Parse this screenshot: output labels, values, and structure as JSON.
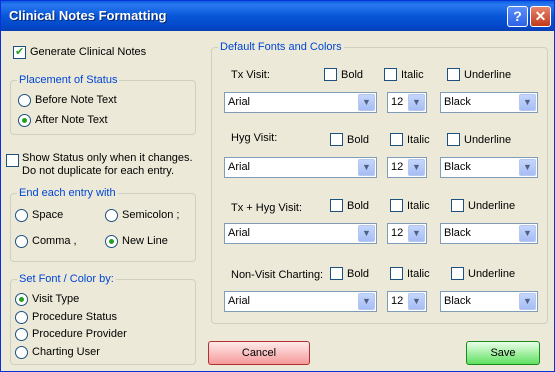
{
  "window": {
    "title": "Clinical Notes Formatting",
    "help_label": "?",
    "close_label": "✕"
  },
  "generate": {
    "label": "Generate Clinical Notes",
    "checked": true
  },
  "placement": {
    "title": "Placement of Status",
    "options": [
      {
        "label": "Before Note Text",
        "selected": false
      },
      {
        "label": "After Note Text",
        "selected": true
      }
    ]
  },
  "show_status": {
    "line1": "Show Status only when it changes.",
    "line2": "Do not duplicate for each entry.",
    "checked": false
  },
  "end_entry": {
    "title": "End each entry with",
    "options": [
      {
        "label": "Space",
        "selected": false
      },
      {
        "label": "Semicolon ;",
        "selected": false
      },
      {
        "label": "Comma ,",
        "selected": false
      },
      {
        "label": "New Line",
        "selected": true
      }
    ]
  },
  "set_font": {
    "title": "Set Font / Color by:",
    "options": [
      {
        "label": "Visit Type",
        "selected": true
      },
      {
        "label": "Procedure Status",
        "selected": false
      },
      {
        "label": "Procedure Provider",
        "selected": false
      },
      {
        "label": "Charting User",
        "selected": false
      }
    ]
  },
  "fonts": {
    "title": "Default Fonts and Colors",
    "bold_label": "Bold",
    "italic_label": "Italic",
    "underline_label": "Underline",
    "rows": [
      {
        "label": "Tx Visit:",
        "font": "Arial",
        "size": "12",
        "color": "Black",
        "bold": false,
        "italic": false,
        "underline": false
      },
      {
        "label": "Hyg Visit:",
        "font": "Arial",
        "size": "12",
        "color": "Black",
        "bold": false,
        "italic": false,
        "underline": false
      },
      {
        "label": "Tx + Hyg Visit:",
        "font": "Arial",
        "size": "12",
        "color": "Black",
        "bold": false,
        "italic": false,
        "underline": false
      },
      {
        "label": "Non-Visit Charting:",
        "font": "Arial",
        "size": "12",
        "color": "Black",
        "bold": false,
        "italic": false,
        "underline": false
      }
    ]
  },
  "buttons": {
    "cancel": "Cancel",
    "save": "Save"
  },
  "icons": {
    "dropdown": "chevron-down-icon"
  }
}
